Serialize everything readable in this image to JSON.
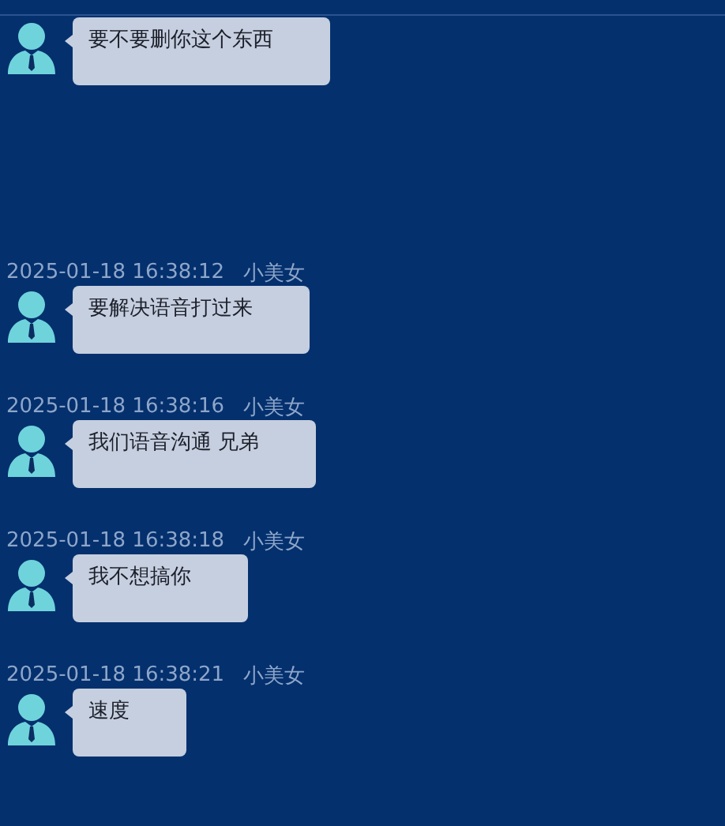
{
  "messages": [
    {
      "text": "要不要删你这个东西"
    },
    {
      "time": "2025-01-18 16:38:12",
      "sender": "小美女",
      "text": "要解决语音打过来"
    },
    {
      "time": "2025-01-18 16:38:16",
      "sender": "小美女",
      "text": "我们语音沟通 兄弟"
    },
    {
      "time": "2025-01-18 16:38:18",
      "sender": "小美女",
      "text": "我不想搞你"
    },
    {
      "time": "2025-01-18 16:38:21",
      "sender": "小美女",
      "text": "速度"
    }
  ]
}
